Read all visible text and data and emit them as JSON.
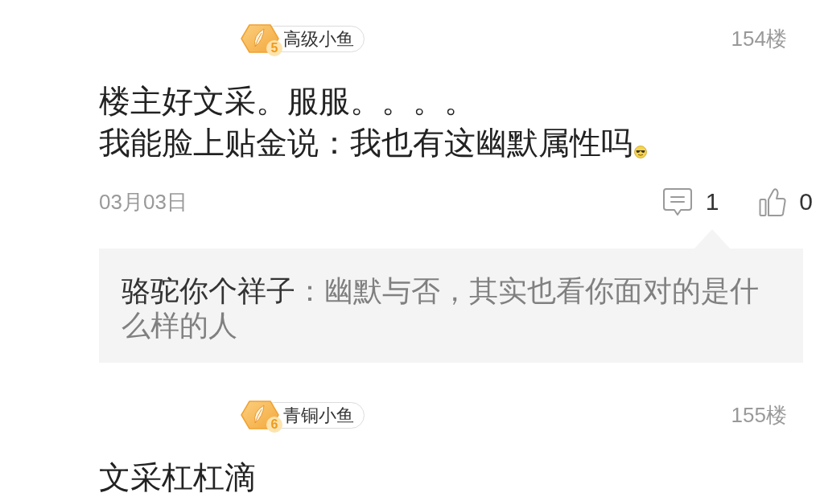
{
  "comments": [
    {
      "badge": {
        "level": "5",
        "title": "高级小鱼"
      },
      "floor": "154楼",
      "lines": [
        {
          "text": "楼主好文采。服服。。。。",
          "emoji": false
        },
        {
          "text": "我能脸上贴金说：我也有这幽默属性吗",
          "emoji": true
        }
      ],
      "date": "03月03日",
      "reply_count": "1",
      "like_count": "0",
      "replies": [
        {
          "author": "骆驼你个祥子",
          "text": "：幽默与否，其实也看你面对的是什么样的人"
        }
      ]
    },
    {
      "badge": {
        "level": "6",
        "title": "青铜小鱼"
      },
      "floor": "155楼",
      "lines": [
        {
          "text": "文采杠杠滴",
          "emoji": false
        }
      ]
    }
  ]
}
